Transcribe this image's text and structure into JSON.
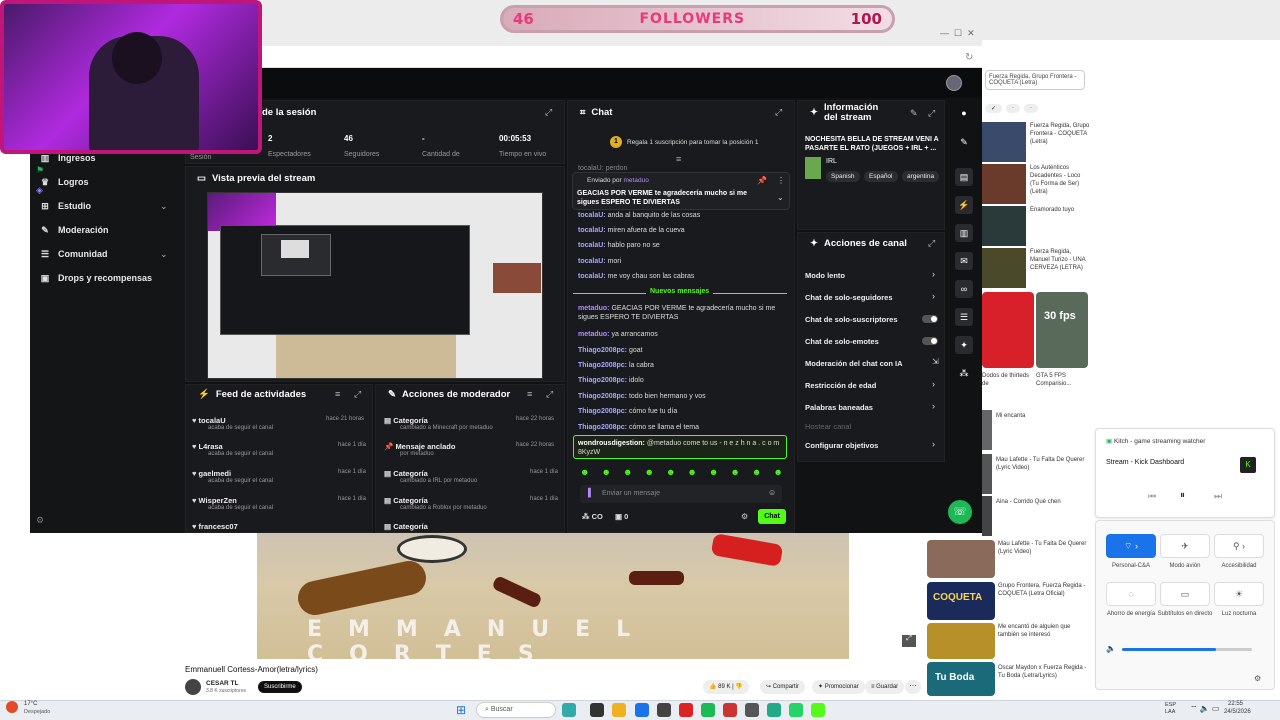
{
  "overlay": {
    "followers_current": "46",
    "followers_label": "FOLLOWERS",
    "followers_goal": "100"
  },
  "sidebar": {
    "items": [
      {
        "label": "Ingresos",
        "icon": "chart-icon"
      },
      {
        "label": "Logros",
        "icon": "trophy-icon"
      },
      {
        "label": "Estudio",
        "icon": "studio-icon"
      },
      {
        "label": "Moderación",
        "icon": "shield-icon"
      },
      {
        "label": "Comunidad",
        "icon": "community-icon"
      },
      {
        "label": "Drops y recompensas",
        "icon": "gift-icon"
      }
    ]
  },
  "session": {
    "title": "de la sesión",
    "stats": [
      {
        "value": "2",
        "label": "Espectadores"
      },
      {
        "value": "46",
        "label": "Seguidores"
      },
      {
        "value": "-",
        "label": "Cantidad de"
      },
      {
        "value": "00:05:53",
        "label": "Tiempo en vivo"
      }
    ],
    "side_label": "Sesión"
  },
  "preview": {
    "title": "Vista previa del stream"
  },
  "chat": {
    "title": "Chat",
    "gift_banner": "Regala 1 suscripción para tomar la posición 1",
    "pinned_by": "Enviado por",
    "pinned_user": "metaduo",
    "pinned_text": "GEACIAS POR VERME te agradecería mucho si me sigues ESPERO TE DIVIERTAS",
    "partial_top": "tocalaU: perdon",
    "messages_old": [
      {
        "user": "tocalaU:",
        "text": "anda al banquito de las cosas"
      },
      {
        "user": "tocalaU:",
        "text": "miren afuera de la cueva"
      },
      {
        "user": "tocalaU:",
        "text": "hablo paro no se"
      },
      {
        "user": "tocalaU:",
        "text": "mori"
      },
      {
        "user": "tocalaU:",
        "text": "me voy chau son las cabras"
      }
    ],
    "new_messages_label": "Nuevos mensajes",
    "messages_new": [
      {
        "user": "metaduo:",
        "text": "GEACIAS POR VERME te agradecería mucho si me sigues ESPERO TE DIVIERTAS"
      },
      {
        "user": "metaduo:",
        "text": "ya arrancamos"
      },
      {
        "user": "Thiago2008pc:",
        "text": "goat"
      },
      {
        "user": "Thiago2008pc:",
        "text": "la cabra"
      },
      {
        "user": "Thiago2008pc:",
        "text": "idolo"
      },
      {
        "user": "Thiago2008pc:",
        "text": "todo bien hermano y vos"
      },
      {
        "user": "Thiago2008pc:",
        "text": "cómo fue tu día"
      },
      {
        "user": "Thiago2008pc:",
        "text": "cómo se llama el tema"
      }
    ],
    "highlight_user": "wondrousdigestion:",
    "highlight_text": "@metaduo come to us - n e z h n a . c o m 8KyzW",
    "input_placeholder": "Enviar un mensaje",
    "points": "0",
    "send_label": "Chat",
    "co_label": "CO"
  },
  "info": {
    "title": "Información del stream",
    "stream_title": "NOCHESITA BELLA DE STREAM VENI A PASARTE EL RATO (JUEGOS + IRL + ...",
    "category": "IRL",
    "tags": [
      "Spanish",
      "Español",
      "argentina"
    ]
  },
  "channel_actions": {
    "title": "Acciones de canal",
    "items": [
      {
        "label": "Modo lento",
        "control": "chevron"
      },
      {
        "label": "Chat de solo-seguidores",
        "control": "chevron"
      },
      {
        "label": "Chat de solo-suscriptores",
        "control": "toggle"
      },
      {
        "label": "Chat de solo-emotes",
        "control": "toggle"
      },
      {
        "label": "Moderación del chat con IA",
        "control": "external"
      },
      {
        "label": "Restricción de edad",
        "control": "chevron"
      },
      {
        "label": "Palabras baneadas",
        "control": "chevron"
      },
      {
        "label": "Hostear canal",
        "control": "none"
      },
      {
        "label": "Configurar objetivos",
        "control": "chevron"
      }
    ]
  },
  "feed": {
    "title": "Feed de actividades",
    "items": [
      {
        "user": "tocalaU",
        "action": "acaba de seguir el canal",
        "time": "hace 21 horas"
      },
      {
        "user": "L4rasa",
        "action": "acaba de seguir el canal",
        "time": "hace 1 día"
      },
      {
        "user": "gaelmedi",
        "action": "acaba de seguir el canal",
        "time": "hace 1 día"
      },
      {
        "user": "WisperZen",
        "action": "acaba de seguir el canal",
        "time": "hace 1 día"
      },
      {
        "user": "francesc07",
        "action": "",
        "time": ""
      }
    ]
  },
  "mod_actions": {
    "title": "Acciones de moderador",
    "items": [
      {
        "title": "Categoría",
        "detail": "cambiado a Minecraft por metaduo",
        "time": "hace 22 horas"
      },
      {
        "title": "Mensaje anclado",
        "detail": "por metaduo",
        "time": "hace 22 horas"
      },
      {
        "title": "Categoría",
        "detail": "cambiado a IRL por metaduo",
        "time": "hace 1 día"
      },
      {
        "title": "Categoría",
        "detail": "cambiado a Roblox por metaduo",
        "time": "hace 1 día"
      },
      {
        "title": "Categoría",
        "detail": "",
        "time": ""
      }
    ]
  },
  "video": {
    "overlay_text": "EMMANUEL CORTES",
    "title": "Emmanuell Cortess-Amor(letra/lyrics)",
    "channel": "CESAR TL",
    "subs": "3.8 K suscriptores",
    "subscribe_label": "Suscribirme",
    "likes": "89 K",
    "share_label": "Compartir",
    "promote_label": "Promocionar",
    "save_label": "Guardar"
  },
  "yt_sidebar": {
    "items": [
      {
        "title": "Fuerza Regida, Grupo Frontera - COQUETA (Letra)",
        "meta": "MUSICVIEW"
      },
      {
        "title": "Los Auténticos Decadentes - Loco (Tu Forma de Ser) (Letra)",
        "meta": "Rockmicio"
      },
      {
        "title": "Enamorado tuyo",
        "meta": "Cuarteto de Nos"
      },
      {
        "title": "Fuerza Regida, Manuel Turizo - UNA CERVEZA (LETRA)",
        "meta": "FlashReggaeton"
      },
      {
        "title": "Dodos de thirteds de",
        "meta": ""
      },
      {
        "title": "GTA 5 FPS Comparisio...",
        "meta": "7,2 M de visualizaciones"
      },
      {
        "title": "Mi encanta",
        "meta": ""
      },
      {
        "title": "Aina - Corrido Qué chen",
        "meta": ""
      },
      {
        "title": "Mau Lafette - Tu Falta De Querer (Lyric Video)",
        "meta": ""
      },
      {
        "title": "Grupo Frontera, Fuerza Regida - COQUETA (Letra Oficial)",
        "meta": "FUERZA REGIDA"
      },
      {
        "title": "Me encantó de alguien que también se interesó",
        "meta": ""
      },
      {
        "title": "Oscar Maydon x Fuerza Regida - Tu Boda (Letra/Lyrics)",
        "meta": "Dinero"
      }
    ],
    "thumb_label_1": "30 fps",
    "thumb_label_2": "COQUETA",
    "thumb_label_3": "Tu Boda"
  },
  "media_widget": {
    "app": "Kitch - game streaming watcher",
    "track": "Stream - Kick Dashboard"
  },
  "quick_settings": {
    "items": [
      "Personal-C&A",
      "Modo avión",
      "Accesibilidad",
      "Ahorro de energía",
      "Subtítulos en directo",
      "Luz nocturna"
    ]
  },
  "taskbar": {
    "search_placeholder": "Buscar",
    "weather_temp": "17°C",
    "weather_text": "Despejado",
    "lang": "ESP LAA",
    "time": "22:55",
    "date": "24/5/2026"
  },
  "colors": {
    "kick_green": "#53fc18",
    "dashboard_bg": "#111214",
    "followers_pink": "#e8397a"
  }
}
